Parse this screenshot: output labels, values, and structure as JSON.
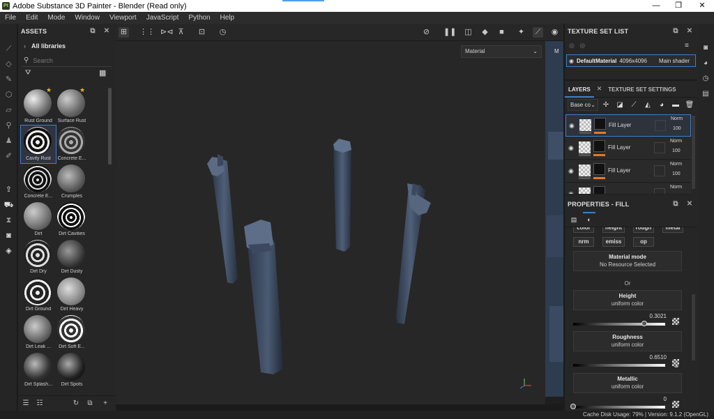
{
  "window": {
    "title": "Adobe Substance 3D Painter - Blender (Read only)",
    "app_icon_text": "Pt"
  },
  "menu": [
    "File",
    "Edit",
    "Mode",
    "Window",
    "Viewport",
    "JavaScript",
    "Python",
    "Help"
  ],
  "assets": {
    "title": "ASSETS",
    "libraries_label": "All libraries",
    "search_placeholder": "Search",
    "items": [
      {
        "label": "Rust Ground",
        "starred": true
      },
      {
        "label": "Surface Rust",
        "starred": true
      },
      {
        "label": "Cavity Rust",
        "selected": true
      },
      {
        "label": "Concrete E..."
      },
      {
        "label": "Concrete E..."
      },
      {
        "label": "Crumples"
      },
      {
        "label": "Dirt"
      },
      {
        "label": "Dirt Cavities"
      },
      {
        "label": "Dirt Dry"
      },
      {
        "label": "Dirt Dusty"
      },
      {
        "label": "Dirt Ground"
      },
      {
        "label": "Dirt Heavy"
      },
      {
        "label": "Dirt Leak ..."
      },
      {
        "label": "Dirt Soft E..."
      },
      {
        "label": "Dirt Splash..."
      },
      {
        "label": "Dirt Spots"
      }
    ]
  },
  "viewport": {
    "mode_dropdown": "Material",
    "uv_button": "M"
  },
  "texture_set_list": {
    "title": "TEXTURE SET LIST",
    "row": {
      "name": "DefaultMaterial",
      "resolution": "4096x4096",
      "shader": "Main shader"
    }
  },
  "layers": {
    "tab_layers": "LAYERS",
    "tab_settings": "TEXTURE SET SETTINGS",
    "blend_channel": "Base co",
    "rows": [
      {
        "name": "Fill Layer",
        "blend": "Norm",
        "opacity": "100"
      },
      {
        "name": "Fill Layer",
        "blend": "Norm",
        "opacity": "100"
      },
      {
        "name": "Fill Layer",
        "blend": "Norm",
        "opacity": "100"
      },
      {
        "name": "",
        "blend": "Norm",
        "opacity": ""
      }
    ]
  },
  "properties": {
    "title": "PROPERTIES - FILL",
    "chips_top": [
      "color",
      "height",
      "rough",
      "metal"
    ],
    "chips": [
      "nrm",
      "emiss",
      "op"
    ],
    "material_mode": {
      "title": "Material mode",
      "value": "No Resource Selected"
    },
    "or_label": "Or",
    "height": {
      "title": "Height",
      "sub": "uniform color",
      "value": "0.3021",
      "fraction": 0.3021
    },
    "roughness": {
      "title": "Roughness",
      "sub": "uniform color",
      "value": "0.6510",
      "fraction": 0.651
    },
    "metallic": {
      "title": "Metallic",
      "sub": "uniform color",
      "value": "0",
      "fraction": 0
    }
  },
  "status": {
    "text": "Cache Disk Usage:  79% | Version: 9.1.2 (OpenGL)"
  },
  "colors": {
    "accent": "#3f7fd0",
    "orange": "#e07b28",
    "star": "#f0b530"
  }
}
